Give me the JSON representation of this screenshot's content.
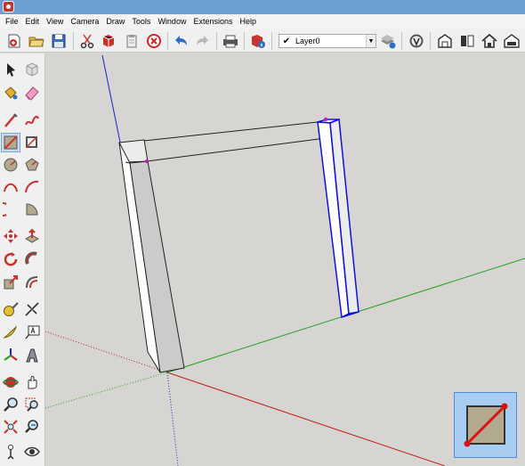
{
  "menu": {
    "items": [
      "File",
      "Edit",
      "View",
      "Camera",
      "Draw",
      "Tools",
      "Window",
      "Extensions",
      "Help"
    ]
  },
  "toolbar": {
    "layer": {
      "current": "Layer0"
    }
  },
  "colors": {
    "titlebar": "#6e9fd1",
    "viewport_bg": "#d6d5d2",
    "axis_red": "#c0241a",
    "axis_green": "#27a020",
    "axis_blue": "#1a24c8",
    "selection_blue": "#1010e0",
    "inference_magenta": "#c020c0",
    "active_tool_highlight": "#a7cdf0"
  },
  "icons": {
    "toolbar": [
      "new-model-icon",
      "open-icon",
      "save-icon",
      "cut-icon",
      "copy-icon",
      "paste-icon",
      "erase-icon",
      "undo-icon",
      "redo-icon",
      "print-icon",
      "model-info-icon",
      "layer-manager-icon",
      "position-camera-icon",
      "warehouse-icon",
      "share-model-icon",
      "component-icon",
      "home-icon",
      "extension-warehouse-icon"
    ],
    "palette": [
      "select-icon",
      "make-component-icon",
      "paint-bucket-icon",
      "eraser-icon",
      "line-icon",
      "freehand-icon",
      "rectangle-icon",
      "rotated-rectangle-icon",
      "circle-icon",
      "polygon-icon",
      "arc-icon",
      "two-point-arc-icon",
      "three-point-arc-icon",
      "pie-icon",
      "move-icon",
      "push-pull-icon",
      "rotate-icon",
      "follow-me-icon",
      "scale-icon",
      "offset-icon",
      "tape-measure-icon",
      "dimension-icon",
      "protractor-icon",
      "text-icon",
      "axes-icon",
      "3d-text-icon",
      "orbit-icon",
      "pan-icon",
      "zoom-icon",
      "zoom-window-icon",
      "zoom-extents-icon",
      "previous-view-icon",
      "position-camera-icon",
      "look-around-icon"
    ]
  }
}
